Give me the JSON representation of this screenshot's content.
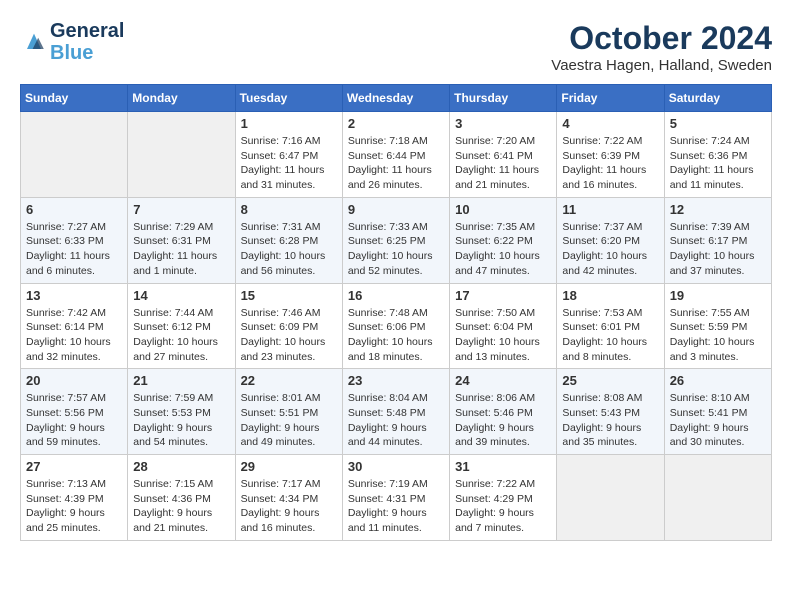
{
  "header": {
    "logo_line1": "General",
    "logo_line2": "Blue",
    "month": "October 2024",
    "location": "Vaestra Hagen, Halland, Sweden"
  },
  "days_of_week": [
    "Sunday",
    "Monday",
    "Tuesday",
    "Wednesday",
    "Thursday",
    "Friday",
    "Saturday"
  ],
  "weeks": [
    [
      {
        "day": "",
        "info": ""
      },
      {
        "day": "",
        "info": ""
      },
      {
        "day": "1",
        "info": "Sunrise: 7:16 AM\nSunset: 6:47 PM\nDaylight: 11 hours and 31 minutes."
      },
      {
        "day": "2",
        "info": "Sunrise: 7:18 AM\nSunset: 6:44 PM\nDaylight: 11 hours and 26 minutes."
      },
      {
        "day": "3",
        "info": "Sunrise: 7:20 AM\nSunset: 6:41 PM\nDaylight: 11 hours and 21 minutes."
      },
      {
        "day": "4",
        "info": "Sunrise: 7:22 AM\nSunset: 6:39 PM\nDaylight: 11 hours and 16 minutes."
      },
      {
        "day": "5",
        "info": "Sunrise: 7:24 AM\nSunset: 6:36 PM\nDaylight: 11 hours and 11 minutes."
      }
    ],
    [
      {
        "day": "6",
        "info": "Sunrise: 7:27 AM\nSunset: 6:33 PM\nDaylight: 11 hours and 6 minutes."
      },
      {
        "day": "7",
        "info": "Sunrise: 7:29 AM\nSunset: 6:31 PM\nDaylight: 11 hours and 1 minute."
      },
      {
        "day": "8",
        "info": "Sunrise: 7:31 AM\nSunset: 6:28 PM\nDaylight: 10 hours and 56 minutes."
      },
      {
        "day": "9",
        "info": "Sunrise: 7:33 AM\nSunset: 6:25 PM\nDaylight: 10 hours and 52 minutes."
      },
      {
        "day": "10",
        "info": "Sunrise: 7:35 AM\nSunset: 6:22 PM\nDaylight: 10 hours and 47 minutes."
      },
      {
        "day": "11",
        "info": "Sunrise: 7:37 AM\nSunset: 6:20 PM\nDaylight: 10 hours and 42 minutes."
      },
      {
        "day": "12",
        "info": "Sunrise: 7:39 AM\nSunset: 6:17 PM\nDaylight: 10 hours and 37 minutes."
      }
    ],
    [
      {
        "day": "13",
        "info": "Sunrise: 7:42 AM\nSunset: 6:14 PM\nDaylight: 10 hours and 32 minutes."
      },
      {
        "day": "14",
        "info": "Sunrise: 7:44 AM\nSunset: 6:12 PM\nDaylight: 10 hours and 27 minutes."
      },
      {
        "day": "15",
        "info": "Sunrise: 7:46 AM\nSunset: 6:09 PM\nDaylight: 10 hours and 23 minutes."
      },
      {
        "day": "16",
        "info": "Sunrise: 7:48 AM\nSunset: 6:06 PM\nDaylight: 10 hours and 18 minutes."
      },
      {
        "day": "17",
        "info": "Sunrise: 7:50 AM\nSunset: 6:04 PM\nDaylight: 10 hours and 13 minutes."
      },
      {
        "day": "18",
        "info": "Sunrise: 7:53 AM\nSunset: 6:01 PM\nDaylight: 10 hours and 8 minutes."
      },
      {
        "day": "19",
        "info": "Sunrise: 7:55 AM\nSunset: 5:59 PM\nDaylight: 10 hours and 3 minutes."
      }
    ],
    [
      {
        "day": "20",
        "info": "Sunrise: 7:57 AM\nSunset: 5:56 PM\nDaylight: 9 hours and 59 minutes."
      },
      {
        "day": "21",
        "info": "Sunrise: 7:59 AM\nSunset: 5:53 PM\nDaylight: 9 hours and 54 minutes."
      },
      {
        "day": "22",
        "info": "Sunrise: 8:01 AM\nSunset: 5:51 PM\nDaylight: 9 hours and 49 minutes."
      },
      {
        "day": "23",
        "info": "Sunrise: 8:04 AM\nSunset: 5:48 PM\nDaylight: 9 hours and 44 minutes."
      },
      {
        "day": "24",
        "info": "Sunrise: 8:06 AM\nSunset: 5:46 PM\nDaylight: 9 hours and 39 minutes."
      },
      {
        "day": "25",
        "info": "Sunrise: 8:08 AM\nSunset: 5:43 PM\nDaylight: 9 hours and 35 minutes."
      },
      {
        "day": "26",
        "info": "Sunrise: 8:10 AM\nSunset: 5:41 PM\nDaylight: 9 hours and 30 minutes."
      }
    ],
    [
      {
        "day": "27",
        "info": "Sunrise: 7:13 AM\nSunset: 4:39 PM\nDaylight: 9 hours and 25 minutes."
      },
      {
        "day": "28",
        "info": "Sunrise: 7:15 AM\nSunset: 4:36 PM\nDaylight: 9 hours and 21 minutes."
      },
      {
        "day": "29",
        "info": "Sunrise: 7:17 AM\nSunset: 4:34 PM\nDaylight: 9 hours and 16 minutes."
      },
      {
        "day": "30",
        "info": "Sunrise: 7:19 AM\nSunset: 4:31 PM\nDaylight: 9 hours and 11 minutes."
      },
      {
        "day": "31",
        "info": "Sunrise: 7:22 AM\nSunset: 4:29 PM\nDaylight: 9 hours and 7 minutes."
      },
      {
        "day": "",
        "info": ""
      },
      {
        "day": "",
        "info": ""
      }
    ]
  ]
}
